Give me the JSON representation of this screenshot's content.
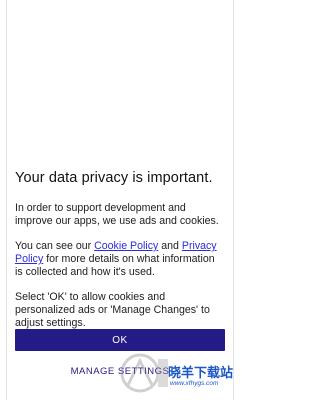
{
  "dialog": {
    "title": "Your data privacy is important.",
    "para1": "In order to support development and improve our apps, we use ads and cookies.",
    "para2_prefix": "You can see our ",
    "cookie_policy_link": "Cookie Policy",
    "para2_and": " and ",
    "privacy_policy_link": "Privacy Policy",
    "para2_suffix": " for more details on what information is collected and how it's used.",
    "para3": "Select 'OK' to allow cookies and personalized ads or 'Manage Changes' to adjust settings.",
    "ok_label": "OK",
    "manage_label": "MANAGE SETTINGS"
  },
  "watermark": {
    "logo_name": "xiaoyang-logo",
    "text": "晓羊下载站",
    "url": "www.xfhygs.com"
  },
  "colors": {
    "primary": "#241b86",
    "link": "#2b2be2",
    "watermark": "#1c57c5"
  }
}
